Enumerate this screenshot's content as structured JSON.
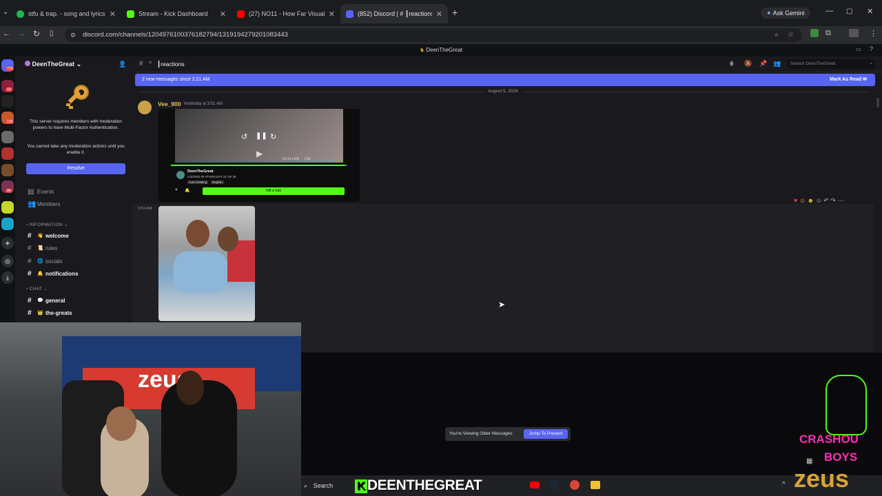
{
  "browser": {
    "tabs": [
      {
        "title": "stfu & trap. - song and lyrics by",
        "color": "#1db954"
      },
      {
        "title": "Stream - Kick Dashboard",
        "color": "#53fc18"
      },
      {
        "title": "(27) NO11 - How Far Visualizer",
        "color": "#ff0000"
      },
      {
        "title": "(852) Discord | # ┃reactions",
        "color": "#5865f2"
      }
    ],
    "ask_gemini": "Ask Gemini",
    "url": "discord.com/channels/1204976100376182794/1319194279201083443"
  },
  "app_title": "DeenTheGreat",
  "server": {
    "name": "DeenTheGreat",
    "mfa_notice": "This server requires members with moderation powers to have Multi-Factor Authentication.",
    "mfa_sub": "You cannot take any moderation actions until you enable it.",
    "resolve_label": "Resolve",
    "nav": [
      "Events",
      "Members"
    ],
    "categories": {
      "information": "INFORMATION",
      "chat": "CHAT"
    },
    "channels": [
      {
        "name": "welcome",
        "emoji": "👋",
        "bold": true,
        "badge": ""
      },
      {
        "name": "rules",
        "emoji": "📜",
        "bold": false,
        "badge": ""
      },
      {
        "name": "socials",
        "emoji": "🌐",
        "bold": false,
        "badge": ""
      },
      {
        "name": "notifications",
        "emoji": "🔔",
        "bold": true,
        "badge": "6"
      },
      {
        "name": "general",
        "emoji": "💬",
        "bold": true,
        "badge": "1"
      },
      {
        "name": "the-greats",
        "emoji": "👑",
        "bold": true,
        "badge": ""
      }
    ]
  },
  "guild_badges": [
    "726",
    "19",
    "135",
    "34"
  ],
  "chat": {
    "channel": "reactions",
    "search_placeholder": "Search DeenTheGreat",
    "new_messages": "2 new messages since 2:21 AM",
    "mark_read": "Mark As Read",
    "date_divider": "August 5, 2026",
    "author": "Vee_900",
    "timestamp": "Yesterday at 3:51 AM",
    "side_time": "3:51 AM",
    "embed": {
      "streamer": "DeenTheGreat",
      "stream_title": "LOCKED IN ATHON DAY 21 OF 45",
      "tags": [
        "Just Chatting",
        "English"
      ],
      "cta": "Gift a Sub",
      "go_live": "Go to LIVE",
      "clip": "Clip"
    },
    "older_notice": "You're Viewing Older Messages",
    "jump_label": "Jump To Present"
  },
  "taskbar": {
    "search": "Search",
    "overlay_name": "DEENTHEGREAT"
  },
  "overlay": {
    "brand1": "CRASHOU",
    "brand2": "BOYS",
    "brand3": "zeus"
  },
  "webcam_text": {
    "chair": "zeus"
  },
  "colors": {
    "blurple": "#5865f2",
    "kick_green": "#53fc18",
    "brand_pink": "#ff2fb3"
  }
}
